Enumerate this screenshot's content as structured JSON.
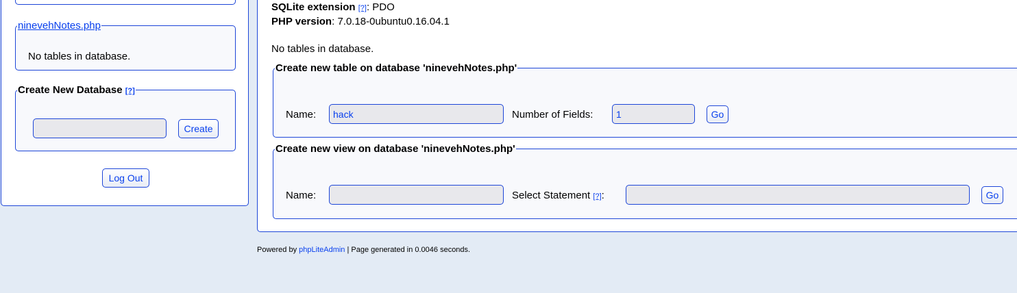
{
  "sidebar": {
    "db_link": "ninevehNotes.php",
    "db_empty_text": "No tables in database.",
    "create_db": {
      "legend": "Create New Database",
      "help": "[?]",
      "input_value": "",
      "button": "Create"
    },
    "logout_button": "Log Out"
  },
  "main": {
    "sqlite_ext_label": "SQLite extension",
    "sqlite_ext_help": "[?]",
    "sqlite_ext_value": ": PDO",
    "php_version_label": "PHP version",
    "php_version_value": ": 7.0.18-0ubuntu0.16.04.1",
    "no_tables_text": "No tables in database.",
    "create_table": {
      "legend": "Create new table on database 'ninevehNotes.php'",
      "name_label": "Name:",
      "name_value": "hack",
      "fields_label": "Number of Fields:",
      "fields_value": "1",
      "go_button": "Go"
    },
    "create_view": {
      "legend": "Create new view on database 'ninevehNotes.php'",
      "name_label": "Name:",
      "name_value": "",
      "select_label": "Select Statement",
      "select_help": "[?]",
      "select_colon": ":",
      "select_value": "",
      "go_button": "Go"
    }
  },
  "footer": {
    "prefix": "Powered by ",
    "link": "phpLiteAdmin",
    "suffix": " | Page generated in 0.0046 seconds."
  },
  "colors": {
    "background": "#e3ebf5",
    "border": "#1d46d8",
    "link": "#0a41ee",
    "input_bg": "#e8e8ec"
  }
}
